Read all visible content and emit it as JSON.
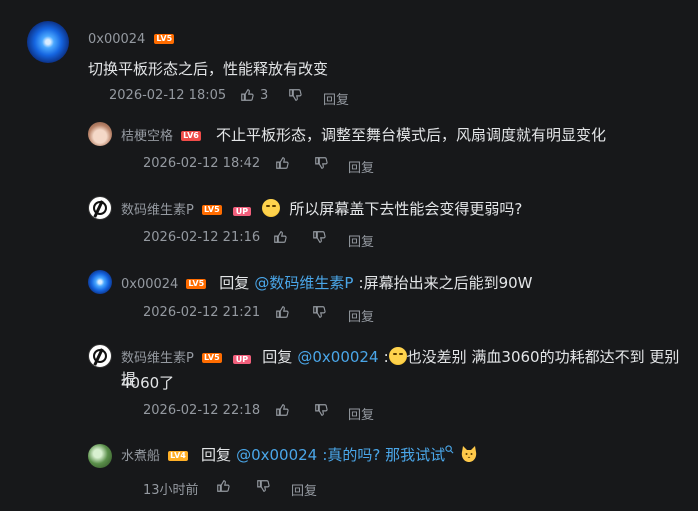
{
  "root": {
    "user": "0x00024",
    "level": "LV5",
    "text": "切换平板形态之后，性能释放有改变",
    "time": "2026-02-12 18:05",
    "likes": "3",
    "reply_label": "回复"
  },
  "replies": [
    {
      "user": "桔梗空格",
      "level": "LV6",
      "text": "不止平板形态，调整至舞台模式后，风扇调度就有明显变化",
      "time": "2026-02-12 18:42",
      "reply_label": "回复"
    },
    {
      "user": "数码维生素P",
      "level": "LV5",
      "badge": "UP",
      "text": "所以屏幕盖下去性能会变得更弱吗?",
      "time": "2026-02-12 21:16",
      "reply_label": "回复"
    },
    {
      "user": "0x00024",
      "level": "LV5",
      "prefix": "回复",
      "mention": "@数码维生素P",
      "text": ":屏幕抬出来之后能到90W",
      "time": "2026-02-12 21:21",
      "reply_label": "回复"
    },
    {
      "user": "数码维生素P",
      "level": "LV5",
      "badge": "UP",
      "prefix": "回复",
      "mention": "@0x00024",
      "colon": ":",
      "text": "也没差别 满血3060的功耗都达不到 更别提",
      "text2": "4060了",
      "time": "2026-02-12 22:18",
      "reply_label": "回复"
    },
    {
      "user": "水煮船",
      "level": "LV4",
      "prefix": "回复",
      "mention": "@0x00024",
      "text": ":真的吗? 那我试试",
      "time": "13小时前",
      "reply_label": "回复"
    }
  ],
  "icons": {
    "like": "thumbs-up-icon",
    "dislike": "thumbs-down-icon",
    "search": "search-icon"
  },
  "colors": {
    "mention": "#4aa6e8",
    "lv5": "#ff6c00",
    "lv6": "#f04c49",
    "lv4": "#ffb027",
    "up": "#f15f7c"
  }
}
